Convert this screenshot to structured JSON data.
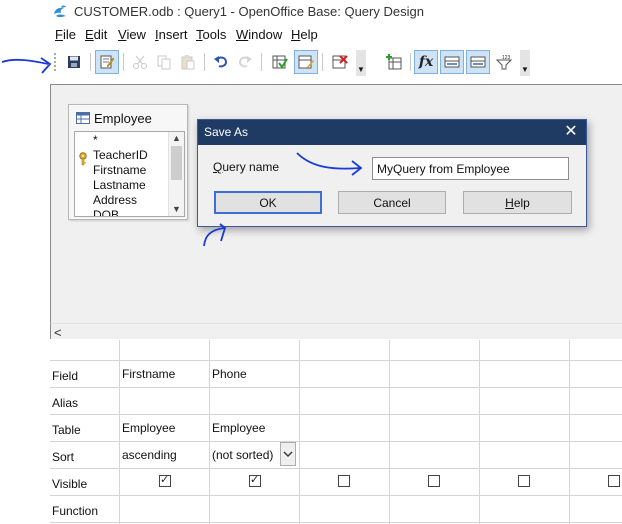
{
  "window": {
    "title": "CUSTOMER.odb : Query1 - OpenOffice Base: Query Design"
  },
  "menu": {
    "items": [
      {
        "label_first": "F",
        "label_rest": "ile"
      },
      {
        "label_first": "E",
        "label_rest": "dit"
      },
      {
        "label_first": "V",
        "label_rest": "iew"
      },
      {
        "label_first": "I",
        "label_rest": "nsert"
      },
      {
        "label_first": "T",
        "label_rest": "ools"
      },
      {
        "label_first": "W",
        "label_rest": "indow"
      },
      {
        "label_first": "H",
        "label_rest": "elp"
      }
    ]
  },
  "toolbar": {
    "icons": [
      "save-icon",
      "edit-mode-icon",
      "cut-icon",
      "copy-icon",
      "paste-icon",
      "undo-icon",
      "redo-icon",
      "run-query-icon",
      "clear-query-icon",
      "design-view-icon",
      "add-tables-icon",
      "functions-icon",
      "table-names-icon",
      "alias-icon",
      "distinct-values-icon"
    ],
    "functions_label": "fx"
  },
  "table_window": {
    "title": "Employee",
    "fields": [
      "*",
      "TeacherID",
      "Firstname",
      "Lastname",
      "Address",
      "DOB"
    ]
  },
  "dialog": {
    "title": "Save As",
    "query_label_first": "Q",
    "query_label_rest": "uery name",
    "query_value": "MyQuery from Employee",
    "ok_label": "OK",
    "cancel_label": "Cancel",
    "help_label_first": "H",
    "help_label_rest": "elp",
    "close_symbol": "✕"
  },
  "scrollbar": {
    "left_arrow": "<"
  },
  "grid": {
    "row_labels": [
      "Field",
      "Alias",
      "Table",
      "Sort",
      "Visible",
      "Function"
    ],
    "columns": [
      {
        "field": "Firstname",
        "alias": "",
        "table": "Employee",
        "sort": "ascending",
        "visible": true,
        "function": ""
      },
      {
        "field": "Phone",
        "alias": "",
        "table": "Employee",
        "sort": "(not sorted)",
        "visible": true,
        "function": ""
      },
      {
        "field": "",
        "alias": "",
        "table": "",
        "sort": "",
        "visible": false,
        "function": ""
      },
      {
        "field": "",
        "alias": "",
        "table": "",
        "sort": "",
        "visible": false,
        "function": ""
      },
      {
        "field": "",
        "alias": "",
        "table": "",
        "sort": "",
        "visible": false,
        "function": ""
      },
      {
        "field": "",
        "alias": "",
        "table": "",
        "sort": "",
        "visible": false,
        "function": ""
      }
    ]
  },
  "colors": {
    "dialog_title_bg": "#1f3a63",
    "annotation_ink": "#1a3ad6",
    "pressed_button": "#cfe3f7"
  }
}
